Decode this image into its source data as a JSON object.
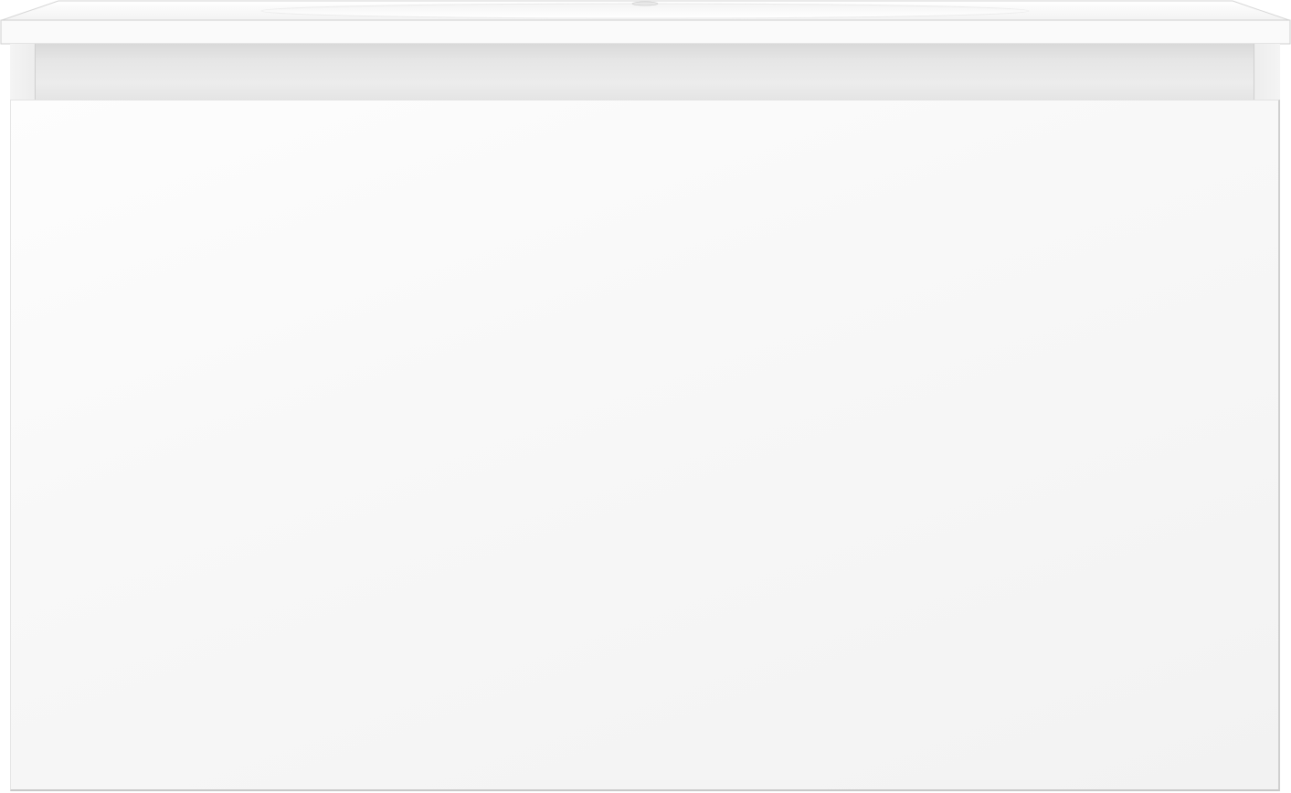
{
  "product": {
    "type": "bathroom-vanity",
    "parts": [
      "basin-top",
      "handle-recess",
      "drawer-front"
    ],
    "colors": {
      "basin": "#ffffff",
      "drawer_front": "#f7f7f7",
      "recess_shadow": "#e3e3e3",
      "outline": "#cfcfcf"
    }
  }
}
